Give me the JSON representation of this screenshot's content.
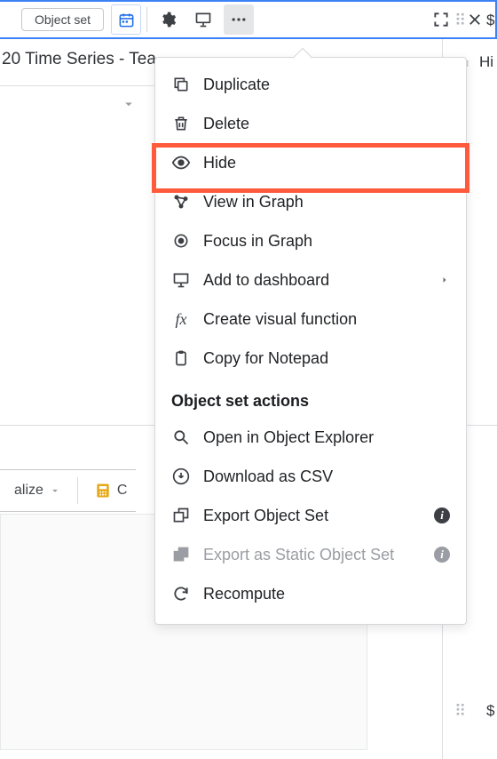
{
  "toolbar": {
    "object_set_label": "Object set"
  },
  "tab_title": "20 Time Series - Tea",
  "right_fragments": {
    "top_right": "$",
    "hi_label": "Hi",
    "bottom_right": "$"
  },
  "lower_strip": {
    "visualize_label": "alize",
    "compute_fragment": "C"
  },
  "menu": {
    "items": [
      {
        "label": "Duplicate"
      },
      {
        "label": "Delete"
      },
      {
        "label": "Hide"
      },
      {
        "label": "View in Graph"
      },
      {
        "label": "Focus in Graph"
      },
      {
        "label": "Add to dashboard",
        "submenu": true
      },
      {
        "label": "Create visual function"
      },
      {
        "label": "Copy for Notepad"
      }
    ],
    "section_heading": "Object set actions",
    "section_items": [
      {
        "label": "Open in Object Explorer"
      },
      {
        "label": "Download as CSV"
      },
      {
        "label": "Export Object Set",
        "info": true
      },
      {
        "label": "Export as Static Object Set",
        "info": true,
        "disabled": true
      },
      {
        "label": "Recompute"
      }
    ]
  }
}
